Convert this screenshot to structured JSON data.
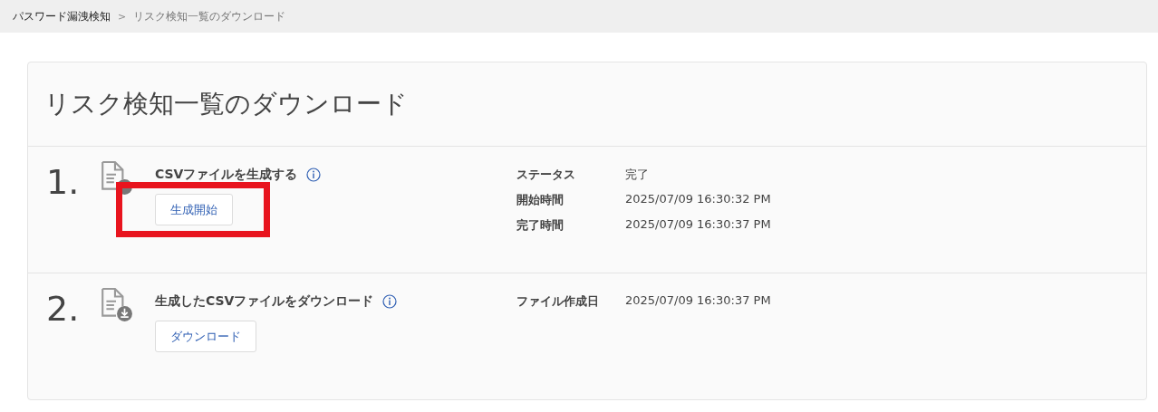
{
  "breadcrumb": [
    {
      "label": "パスワード漏洩検知",
      "current": false
    },
    {
      "label": ">",
      "kind": "separator"
    },
    {
      "label": "リスク検知一覧のダウンロード",
      "current": true
    }
  ],
  "title": "リスク検知一覧のダウンロード",
  "steps": [
    {
      "number": "1.",
      "kind": "generate",
      "title": "CSVファイルを生成する",
      "button": "生成開始",
      "highlighted": true,
      "details": [
        {
          "label": "ステータス",
          "value": "完了"
        },
        {
          "label": "開始時間",
          "value": "2025/07/09 16:30:32 PM"
        },
        {
          "label": "完了時間",
          "value": "2025/07/09 16:30:37 PM"
        }
      ]
    },
    {
      "number": "2.",
      "kind": "download",
      "title": "生成したCSVファイルをダウンロード",
      "button": "ダウンロード",
      "highlighted": false,
      "details": [
        {
          "label": "ファイル作成日",
          "value": "2025/07/09 16:30:37 PM"
        }
      ]
    }
  ]
}
